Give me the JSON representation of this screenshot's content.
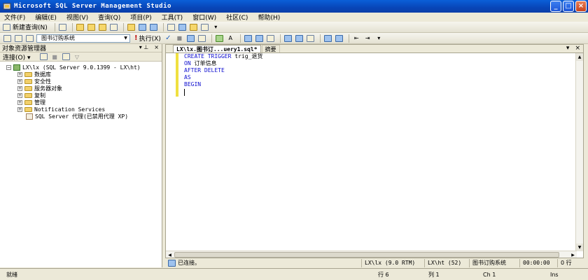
{
  "window": {
    "title": "Microsoft SQL Server Management Studio",
    "buttons": [
      "_",
      "□",
      "×"
    ]
  },
  "menu": [
    "文件(F)",
    "编辑(E)",
    "视图(V)",
    "查询(Q)",
    "项目(P)",
    "工具(T)",
    "窗口(W)",
    "社区(C)",
    "帮助(H)"
  ],
  "toolbar1": {
    "new_query_label": "新建查询(N)"
  },
  "toolbar2": {
    "database": "图书订购系统",
    "execute_label": "执行(X)"
  },
  "object_explorer": {
    "title": "对象资源管理器",
    "pin": "▾ ⊥",
    "close": "×",
    "connect_label": "连接(O) ▾",
    "server": "LX\\lx (SQL Server 9.0.1399 - LX\\ht)",
    "nodes": [
      "数据库",
      "安全性",
      "服务器对象",
      "复制",
      "管理",
      "Notification Services"
    ],
    "agent": "SQL Server 代理(已禁用代理 XP)"
  },
  "editor": {
    "active_tab": "LX\\lx.图书订...uery1.sql*",
    "inactive_tab": "摘要",
    "code_lines": [
      {
        "kw": "CREATE TRIGGER",
        "rest": " trig_退货"
      },
      {
        "kw": "ON",
        "rest": " 订单信息"
      },
      {
        "kw": "AFTER DELETE",
        "rest": ""
      },
      {
        "kw": "AS",
        "rest": ""
      },
      {
        "kw": "BEGIN",
        "rest": ""
      }
    ]
  },
  "query_status": {
    "connected": "已连接。",
    "server": "LX\\lx (9.0 RTM)",
    "user": "LX\\ht (52)",
    "database": "图书订购系统",
    "time": "00:00:00",
    "rows": "0 行"
  },
  "statusbar": {
    "ready": "就绪",
    "line": "行 6",
    "col": "列 1",
    "ch": "Ch 1",
    "ins": "Ins"
  }
}
